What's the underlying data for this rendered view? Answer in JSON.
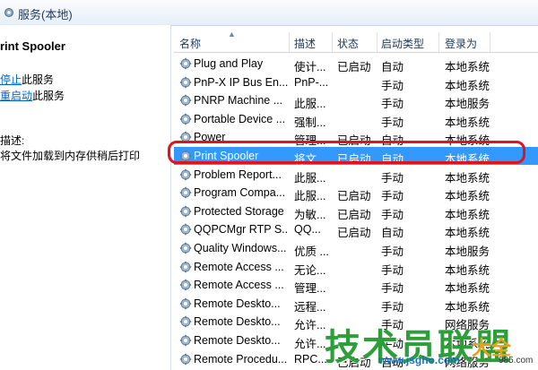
{
  "window": {
    "title": "服务(本地)"
  },
  "left_pane": {
    "service_name": "rint Spooler",
    "stop_link": "停止",
    "stop_suffix": "此服务",
    "restart_link": "重启动",
    "restart_suffix": "此服务",
    "description_label": "描述:",
    "description_text": "将文件加载到内存供稍后打印"
  },
  "table": {
    "columns": [
      "名称",
      "描述",
      "状态",
      "启动类型",
      "登录为"
    ],
    "rows": [
      {
        "name": "Plug and Play",
        "desc": "使计...",
        "status": "已启动",
        "startup": "自动",
        "logon": "本地系统"
      },
      {
        "name": "PnP-X IP Bus En...",
        "desc": "PnP-...",
        "status": "",
        "startup": "手动",
        "logon": "本地系统"
      },
      {
        "name": "PNRP Machine ...",
        "desc": "此服...",
        "status": "",
        "startup": "手动",
        "logon": "本地服务"
      },
      {
        "name": "Portable Device ...",
        "desc": "强制...",
        "status": "",
        "startup": "手动",
        "logon": "本地系统"
      },
      {
        "name": "Power",
        "desc": "管理...",
        "status": "已启动",
        "startup": "自动",
        "logon": "本地系统"
      },
      {
        "name": "Print Spooler",
        "desc": "将文...",
        "status": "已启动",
        "startup": "自动",
        "logon": "本地系统"
      },
      {
        "name": "Problem Report...",
        "desc": "此服...",
        "status": "",
        "startup": "手动",
        "logon": "本地系统"
      },
      {
        "name": "Program Compa...",
        "desc": "此服...",
        "status": "已启动",
        "startup": "手动",
        "logon": "本地系统"
      },
      {
        "name": "Protected Storage",
        "desc": "为敏...",
        "status": "已启动",
        "startup": "手动",
        "logon": "本地系统"
      },
      {
        "name": "QQPCMgr RTP S...",
        "desc": "QQ...",
        "status": "已启动",
        "startup": "自动",
        "logon": "本地系统"
      },
      {
        "name": "Quality Windows...",
        "desc": "优质 ...",
        "status": "",
        "startup": "手动",
        "logon": "本地服务"
      },
      {
        "name": "Remote Access ...",
        "desc": "无论...",
        "status": "",
        "startup": "手动",
        "logon": "本地系统"
      },
      {
        "name": "Remote Access ...",
        "desc": "管理...",
        "status": "",
        "startup": "手动",
        "logon": "本地系统"
      },
      {
        "name": "Remote Deskto...",
        "desc": "远程...",
        "status": "",
        "startup": "手动",
        "logon": "本地系统"
      },
      {
        "name": "Remote Deskto...",
        "desc": "允许...",
        "status": "",
        "startup": "手动",
        "logon": "网络服务"
      },
      {
        "name": "Remote Deskto...",
        "desc": "允许...",
        "status": "",
        "startup": "手动",
        "logon": "本地系统"
      },
      {
        "name": "Remote Procedu...",
        "desc": "RPC...",
        "status": "已启动",
        "startup": "自动",
        "logon": "网络服务"
      }
    ],
    "selected_index": 5
  },
  "watermark": {
    "text": "技术员联盟",
    "suffix": "大全",
    "url": "www.jsgho.com",
    "url2": "985.com"
  },
  "colors": {
    "selection": "#3399ff",
    "highlight": "#e0141e",
    "watermark": "#2d9e3a"
  }
}
